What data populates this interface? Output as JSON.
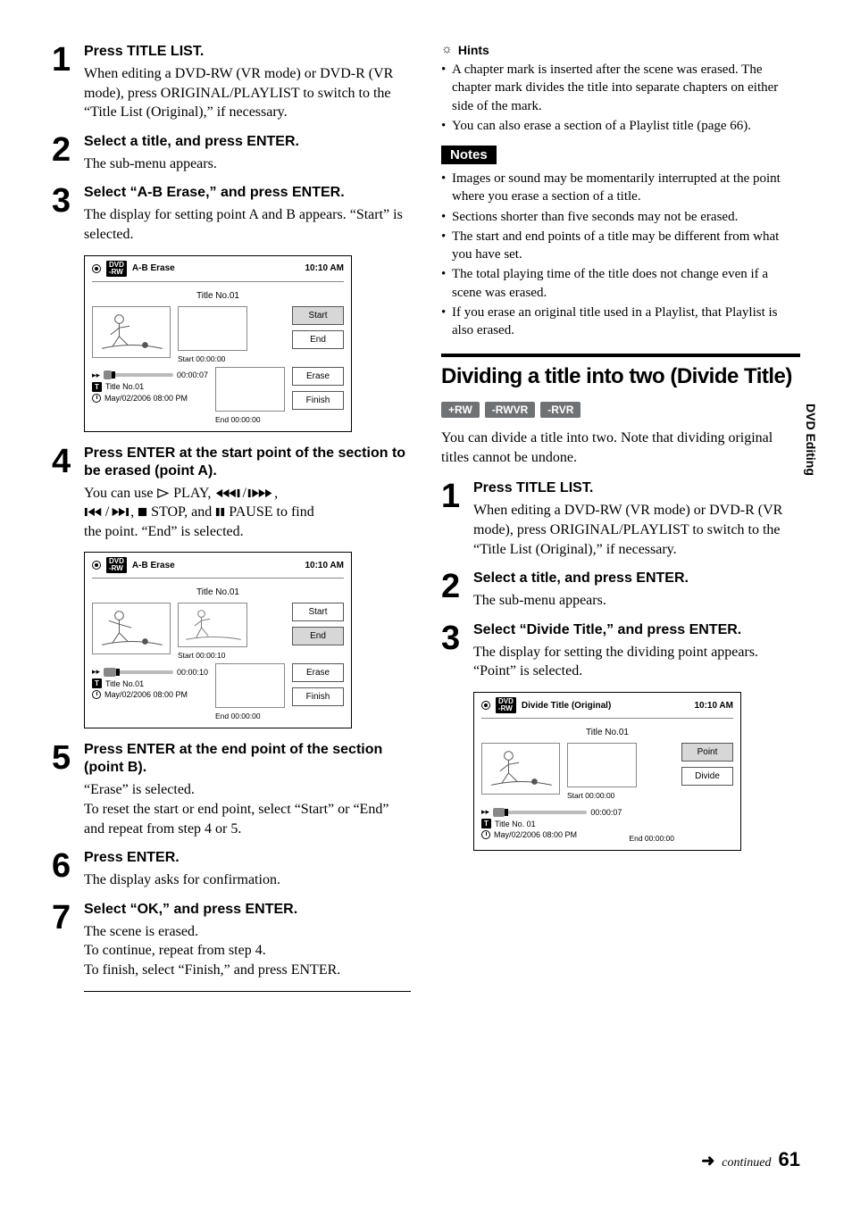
{
  "left": {
    "steps": [
      {
        "num": "1",
        "title": "Press TITLE LIST.",
        "desc": "When editing a DVD-RW (VR mode) or DVD-R (VR mode), press ORIGINAL/PLAYLIST to switch to the “Title List (Original),” if necessary."
      },
      {
        "num": "2",
        "title": "Select a title, and press ENTER.",
        "desc": "The sub-menu appears."
      },
      {
        "num": "3",
        "title": "Select “A-B Erase,” and press ENTER.",
        "desc": "The display for setting point A and B appears. “Start” is selected."
      },
      {
        "num": "4",
        "title": "Press ENTER at the start point of the section to be erased (point A).",
        "desc_b": "the point. “End” is selected."
      },
      {
        "num": "5",
        "title": "Press ENTER at the end point of the section (point B).",
        "desc": "“Erase” is selected.\nTo reset the start or end point, select “Start” or “End” and repeat from step 4 or 5."
      },
      {
        "num": "6",
        "title": "Press ENTER.",
        "desc": "The display asks for confirmation."
      },
      {
        "num": "7",
        "title": "Select “OK,” and press ENTER.",
        "desc": "The scene is erased.\nTo continue, repeat from step 4.\nTo finish, select “Finish,” and press ENTER."
      }
    ],
    "step4_line1_a": "You can use ",
    "step4_line1_b": " PLAY, ",
    "step4_line2_b": " STOP, and ",
    "step4_line2_c": " PAUSE to find"
  },
  "right": {
    "hints_label": "Hints",
    "hints": [
      "A chapter mark is inserted after the scene was erased. The chapter mark divides the title into separate chapters on either side of the mark.",
      "You can also erase a section of a Playlist title (page 66)."
    ],
    "notes_label": "Notes",
    "notes": [
      "Images or sound may be momentarily interrupted at the point where you erase a section of a title.",
      "Sections shorter than five seconds may not be erased.",
      "The start and end points of a title may be different from what you have set.",
      "The total playing time of the title does not change even if a scene was erased.",
      "If you erase an original title used in a Playlist, that Playlist is also erased."
    ],
    "section_title": "Dividing a title into two (Divide Title)",
    "tags": [
      "+RW",
      "-RWVR",
      "-RVR"
    ],
    "section_desc": "You can divide a title into two. Note that dividing original titles cannot be undone.",
    "steps": [
      {
        "num": "1",
        "title": "Press TITLE LIST.",
        "desc": "When editing a DVD-RW (VR mode) or DVD-R (VR mode), press ORIGINAL/PLAYLIST to switch to the “Title List (Original),” if necessary."
      },
      {
        "num": "2",
        "title": "Select a title, and press ENTER.",
        "desc": "The sub-menu appears."
      },
      {
        "num": "3",
        "title": "Select “Divide Title,” and press ENTER.",
        "desc": "The display for setting the dividing point appears.\n“Point” is selected."
      }
    ]
  },
  "screen1": {
    "header": "A-B Erase",
    "clock": "10:10 AM",
    "title_row": "Title No.01",
    "start_caption": "Start 00:00:00",
    "end_caption": "End   00:00:00",
    "elapsed": "00:00:07",
    "info_title": "Title No.01",
    "info_date": "May/02/2006  08:00  PM",
    "btns": {
      "start": "Start",
      "end": "End",
      "erase": "Erase",
      "finish": "Finish"
    },
    "highlight": "start"
  },
  "screen2": {
    "header": "A-B Erase",
    "clock": "10:10 AM",
    "title_row": "Title No.01",
    "start_caption": "Start 00:00:10",
    "end_caption": "End   00:00:00",
    "elapsed": "00:00:10",
    "info_title": "Title No.01",
    "info_date": "May/02/2006  08:00  PM",
    "btns": {
      "start": "Start",
      "end": "End",
      "erase": "Erase",
      "finish": "Finish"
    },
    "highlight": "end"
  },
  "screen3": {
    "header": "Divide Title (Original)",
    "clock": "10:10 AM",
    "title_row": "Title No.01",
    "start_caption": "Start 00:00:00",
    "end_caption": "End   00:00:00",
    "elapsed": "00:00:07",
    "info_title": "Title No. 01",
    "info_date": "May/02/2006  08:00  PM",
    "btns": {
      "point": "Point",
      "divide": "Divide"
    },
    "highlight": "point"
  },
  "dvd_badge": "DVD\n-RW",
  "t_letter": "T",
  "side_label": "DVD Editing",
  "continued": "continued",
  "page": "61"
}
